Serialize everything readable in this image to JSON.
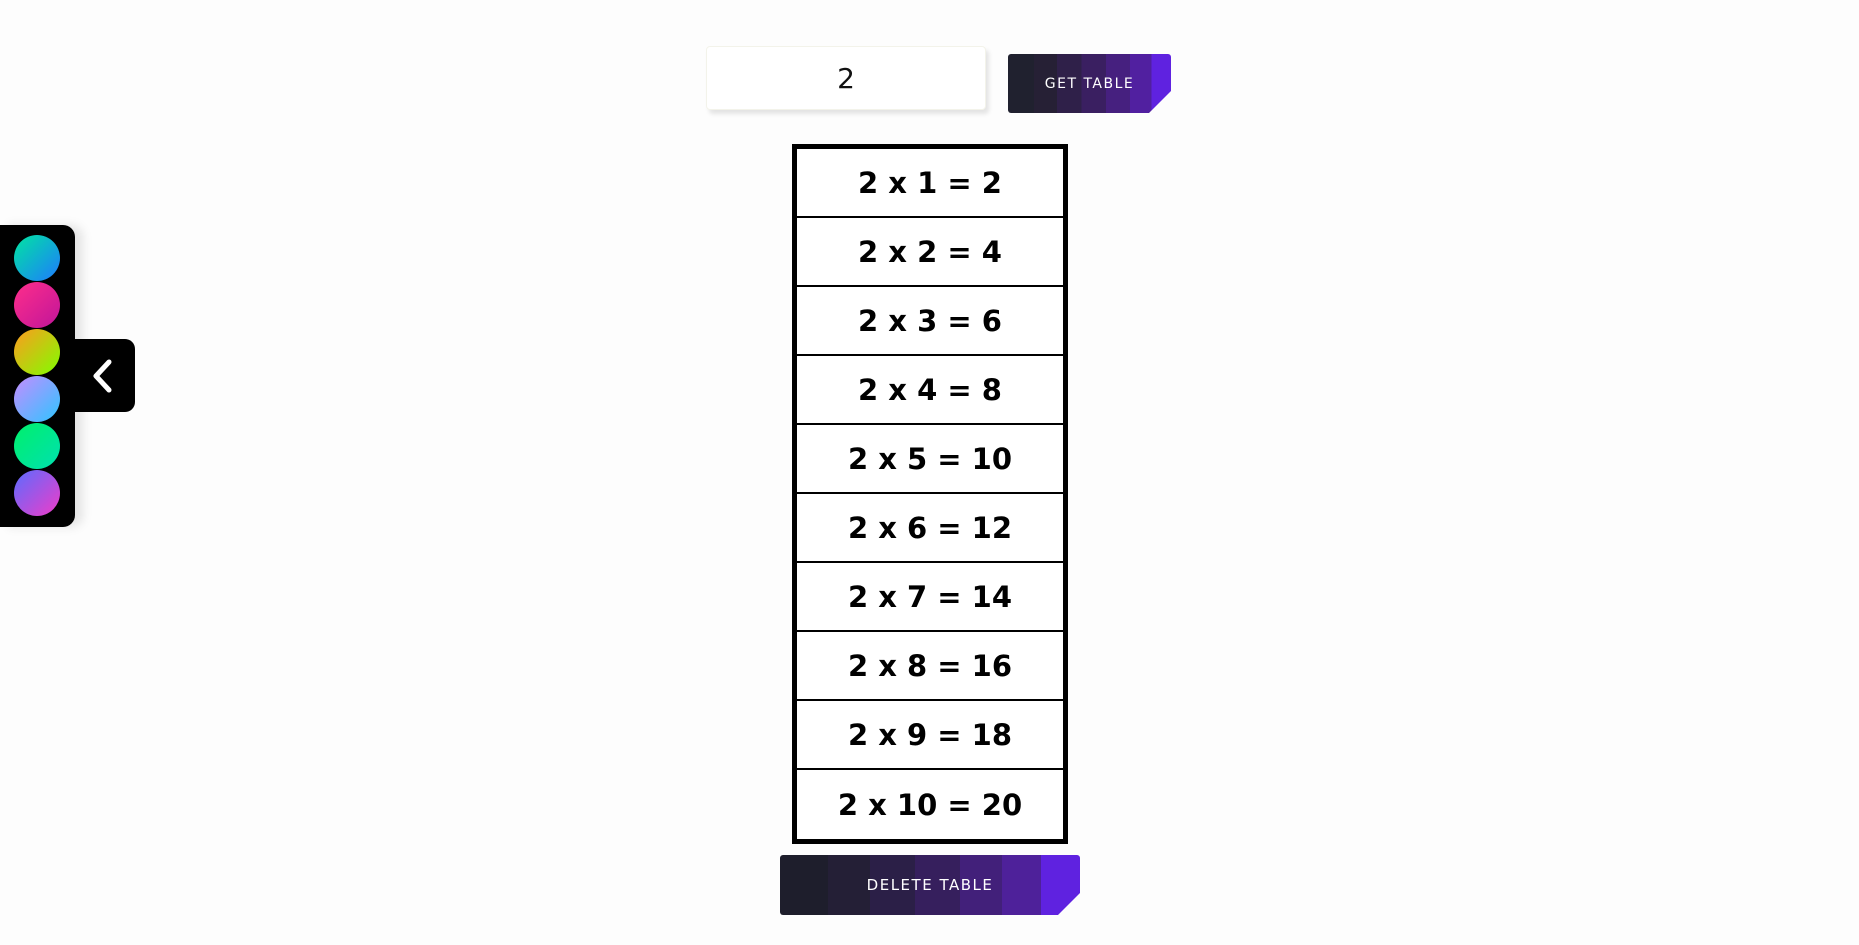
{
  "controls": {
    "number_value": "2",
    "get_button_label": "GET TABLE",
    "delete_button_label": "DELETE TABLE"
  },
  "table": {
    "rows": [
      "2 x 1 = 2",
      "2 x 2 = 4",
      "2 x 3 = 6",
      "2 x 4 = 8",
      "2 x 5 = 10",
      "2 x 6 = 12",
      "2 x 7 = 14",
      "2 x 8 = 16",
      "2 x 9 = 18",
      "2 x 10 = 20"
    ]
  },
  "palette": {
    "swatches": [
      {
        "name": "teal-blue",
        "from": "#00e5a0",
        "to": "#1e7bff"
      },
      {
        "name": "pink-red",
        "from": "#ff2e8a",
        "to": "#c0159a"
      },
      {
        "name": "orange-lime",
        "from": "#ff9a1f",
        "to": "#7fff00"
      },
      {
        "name": "lilac-sky",
        "from": "#c58cff",
        "to": "#2ec5ff"
      },
      {
        "name": "green-mint",
        "from": "#00f06a",
        "to": "#00e0b0"
      },
      {
        "name": "purple-magenta",
        "from": "#5b6cff",
        "to": "#f03cc8"
      }
    ],
    "toggle_icon": "chevron-left-icon"
  }
}
